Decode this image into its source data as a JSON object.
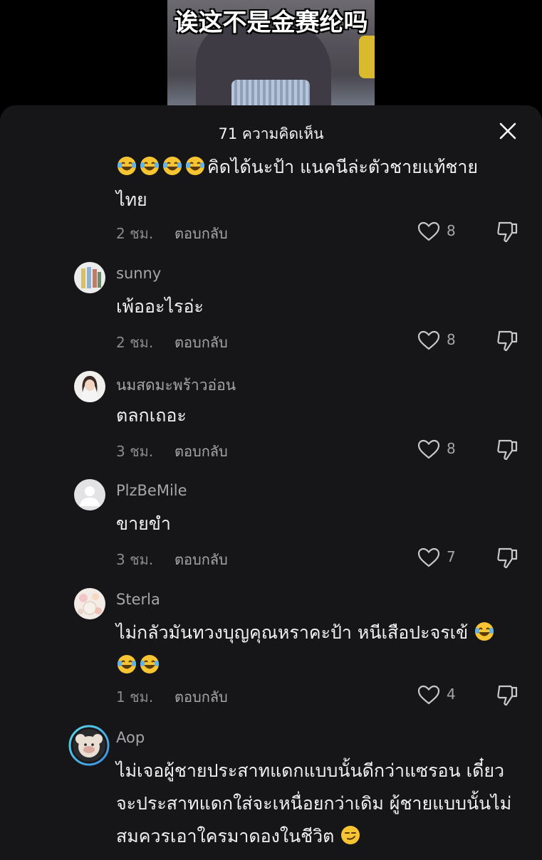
{
  "video": {
    "caption": "诶这不是金赛纶吗"
  },
  "sheet": {
    "title": "71 ความคิดเห็น",
    "close_icon": "close-icon"
  },
  "actions": {
    "reply_label": "ตอบกลับ"
  },
  "comments": [
    {
      "text": "คิดได้นะป้า แนคนีล่ะตัวชายแท้ชาย",
      "text2": "ไทย",
      "time": "2 ชม.",
      "likes": "8",
      "emoji_prefix": 4
    },
    {
      "username": "sunny",
      "text": "เพ้ออะไรอ่ะ",
      "time": "2 ชม.",
      "likes": "8"
    },
    {
      "username": "นมสดมะพร้าวอ่อน",
      "text": "ตลกเถอะ",
      "time": "3 ชม.",
      "likes": "8"
    },
    {
      "username": "PlzBeMile",
      "text": "ขายขำ",
      "time": "3 ชม.",
      "likes": "7"
    },
    {
      "username": "Sterla",
      "text": "ไม่กลัวมันทวงบุญคุณหราคะป้า หนีเสือปะจรเข้",
      "time": "1 ชม.",
      "likes": "4"
    },
    {
      "username": "Aop",
      "text": "ไม่เจอผู้ชายประสาทแดกแบบนั้นดีกว่าแซรอน เดี๋ยว",
      "text2": "จะประสาทแดกใส่จะเหนื่อยกว่าเดิม ผู้ชายแบบนั้นไม่",
      "text3": "สมควรเอาใครมาดองในชีวิต"
    }
  ],
  "colors": {
    "sheet_bg": "#161618",
    "text": "#f0f0f0",
    "muted": "#a6a6a8",
    "emoji_yellow": "#f7c534"
  }
}
